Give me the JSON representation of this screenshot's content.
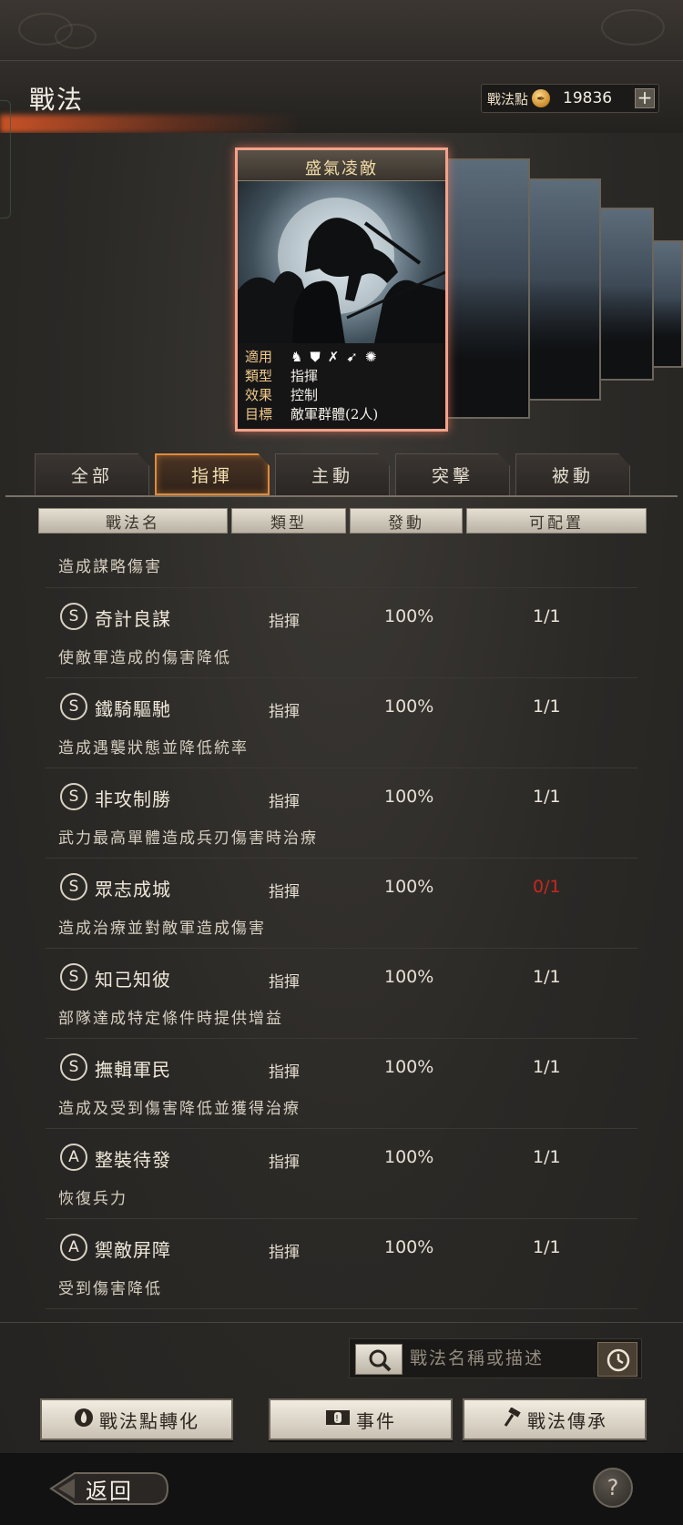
{
  "header": {
    "title": "戰法",
    "points_label": "戰法點",
    "points_value": "19836",
    "plus_label": "+"
  },
  "card": {
    "title": "盛氣凌敵",
    "rows": [
      {
        "key": "適用",
        "value": ""
      },
      {
        "key": "類型",
        "value": "指揮"
      },
      {
        "key": "效果",
        "value": "控制"
      },
      {
        "key": "目標",
        "value": "敵軍群體(2人)"
      }
    ],
    "applicable_icons": [
      "cavalry-icon",
      "shield-icon",
      "bow-icon",
      "spear-icon",
      "siege-icon"
    ]
  },
  "tabs": [
    {
      "label": "全部",
      "active": false
    },
    {
      "label": "指揮",
      "active": true
    },
    {
      "label": "主動",
      "active": false
    },
    {
      "label": "突擊",
      "active": false
    },
    {
      "label": "被動",
      "active": false
    }
  ],
  "columns": [
    "戰法名",
    "類型",
    "發動",
    "可配置"
  ],
  "list": {
    "intro_desc": "造成謀略傷害",
    "items": [
      {
        "grade": "S",
        "name": "奇計良謀",
        "type": "指揮",
        "rate": "100%",
        "slots": "1/1",
        "desc": "使敵軍造成的傷害降低",
        "slots_color": "#ece6da"
      },
      {
        "grade": "S",
        "name": "鐵騎驅馳",
        "type": "指揮",
        "rate": "100%",
        "slots": "1/1",
        "desc": "造成遇襲狀態並降低統率",
        "slots_color": "#ece6da"
      },
      {
        "grade": "S",
        "name": "非攻制勝",
        "type": "指揮",
        "rate": "100%",
        "slots": "1/1",
        "desc": "武力最高單體造成兵刃傷害時治療",
        "slots_color": "#ece6da"
      },
      {
        "grade": "S",
        "name": "眾志成城",
        "type": "指揮",
        "rate": "100%",
        "slots": "0/1",
        "desc": "造成治療並對敵軍造成傷害",
        "slots_color": "#c8281e"
      },
      {
        "grade": "S",
        "name": "知己知彼",
        "type": "指揮",
        "rate": "100%",
        "slots": "1/1",
        "desc": "部隊達成特定條件時提供增益",
        "slots_color": "#ece6da"
      },
      {
        "grade": "S",
        "name": "撫輯軍民",
        "type": "指揮",
        "rate": "100%",
        "slots": "1/1",
        "desc": "造成及受到傷害降低並獲得治療",
        "slots_color": "#ece6da"
      },
      {
        "grade": "A",
        "name": "整裝待發",
        "type": "指揮",
        "rate": "100%",
        "slots": "1/1",
        "desc": "恢復兵力",
        "slots_color": "#ece6da"
      },
      {
        "grade": "A",
        "name": "禦敵屏障",
        "type": "指揮",
        "rate": "100%",
        "slots": "1/1",
        "desc": "受到傷害降低",
        "slots_color": "#ece6da"
      }
    ]
  },
  "search": {
    "placeholder": "戰法名稱或描述"
  },
  "actions": {
    "convert_label": "戰法點轉化",
    "event_label": "事件",
    "inherit_label": "戰法傳承"
  },
  "footer": {
    "back_label": "返回",
    "help_label": "?"
  },
  "colors": {
    "accent": "#e08a3a",
    "card_border": "#f4a28a",
    "warning": "#c8281e"
  }
}
